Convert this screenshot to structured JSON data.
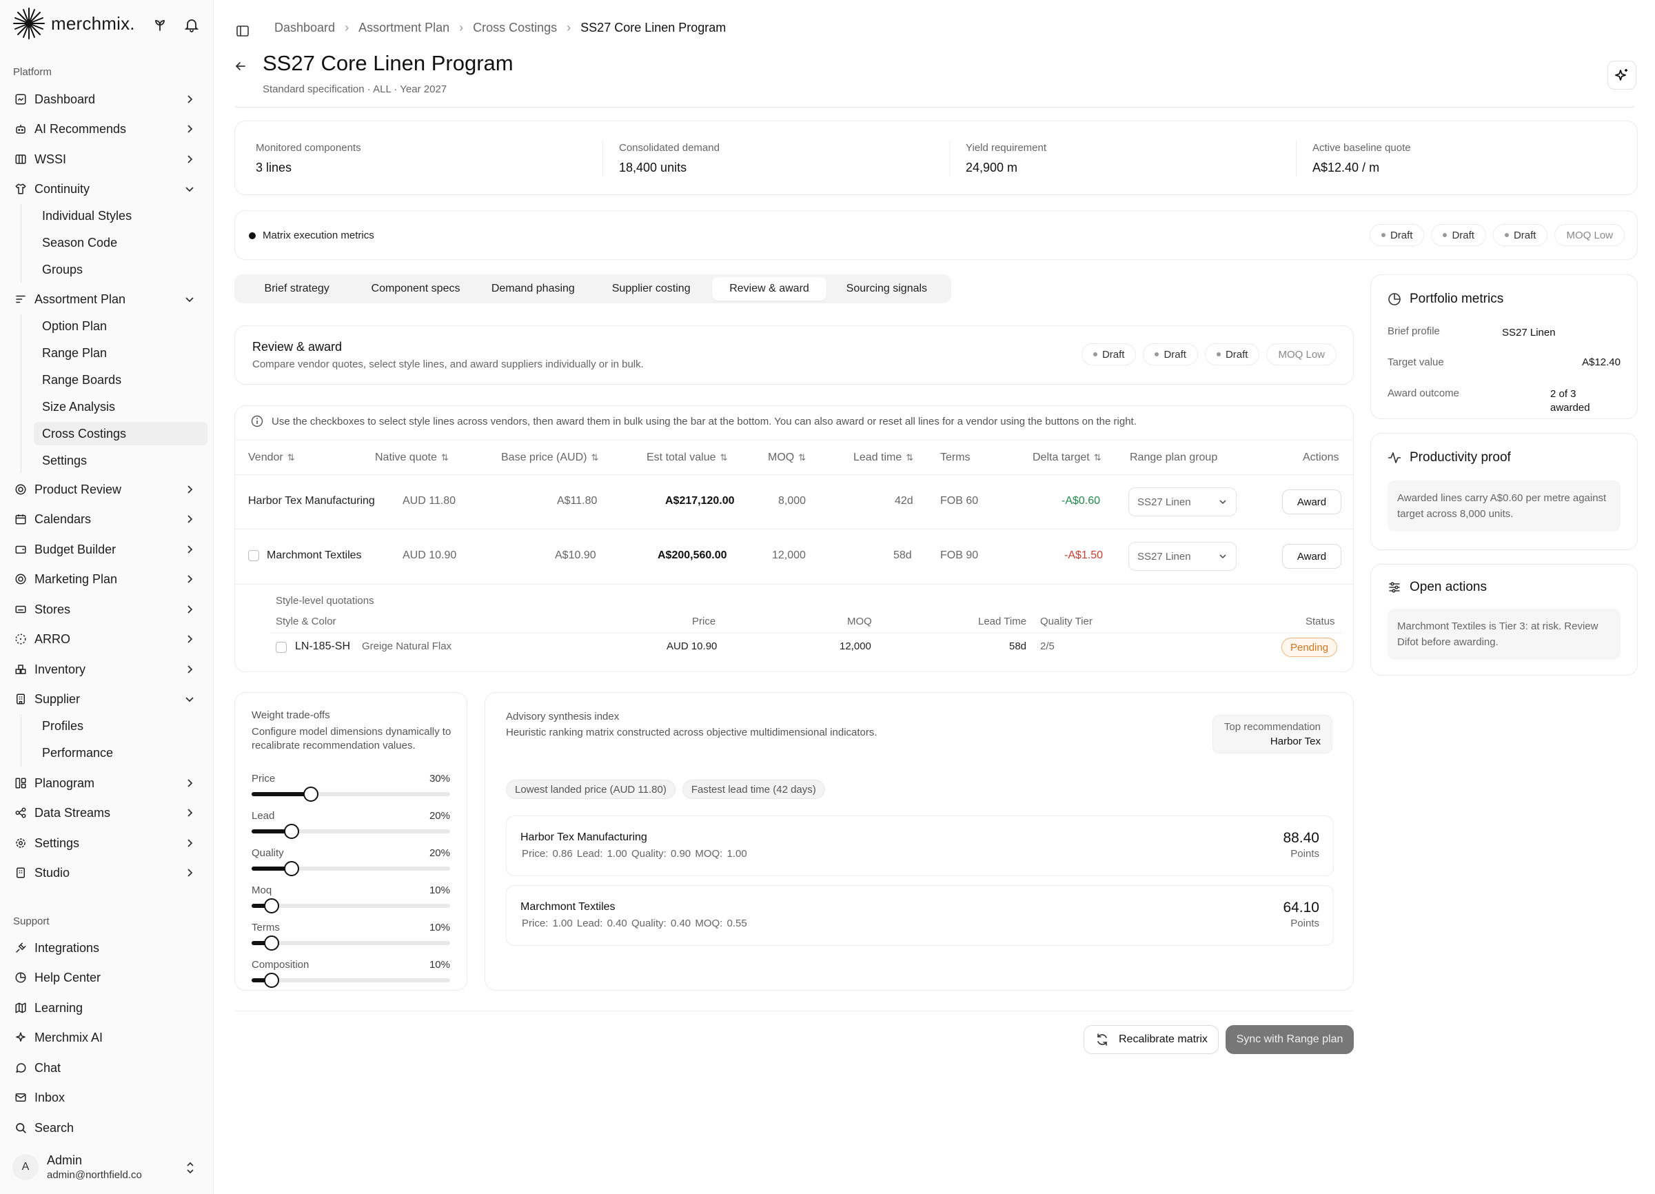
{
  "brand": {
    "name": "merchmix."
  },
  "sidebar": {
    "platform_label": "Platform",
    "support_label": "Support",
    "items": [
      {
        "label": "Dashboard"
      },
      {
        "label": "AI Recommends"
      },
      {
        "label": "WSSI"
      },
      {
        "label": "Continuity"
      },
      {
        "label": "Assortment Plan"
      },
      {
        "label": "Product Review"
      },
      {
        "label": "Calendars"
      },
      {
        "label": "Budget Builder"
      },
      {
        "label": "Marketing Plan"
      },
      {
        "label": "Stores"
      },
      {
        "label": "ARRO"
      },
      {
        "label": "Inventory"
      },
      {
        "label": "Supplier"
      },
      {
        "label": "Planogram"
      },
      {
        "label": "Data Streams"
      },
      {
        "label": "Settings"
      },
      {
        "label": "Studio"
      }
    ],
    "continuity_sub": [
      "Individual Styles",
      "Season Code",
      "Groups"
    ],
    "assortment_sub": [
      "Option Plan",
      "Range Plan",
      "Range Boards",
      "Size Analysis",
      "Cross Costings",
      "Settings"
    ],
    "supplier_sub": [
      "Profiles",
      "Performance"
    ],
    "support_items": [
      {
        "label": "Integrations"
      },
      {
        "label": "Help Center"
      },
      {
        "label": "Learning"
      },
      {
        "label": "Merchmix AI"
      },
      {
        "label": "Chat"
      },
      {
        "label": "Inbox"
      },
      {
        "label": "Search"
      }
    ],
    "user": {
      "initial": "A",
      "name": "Admin",
      "email": "admin@northfield.co"
    }
  },
  "breadcrumb": [
    "Dashboard",
    "Assortment Plan",
    "Cross Costings",
    "SS27 Core Linen Program"
  ],
  "page": {
    "title": "SS27 Core Linen Program",
    "subtitle": "Standard specification · ALL · Year 2027"
  },
  "metrics": [
    {
      "label": "Monitored components",
      "value": "3 lines"
    },
    {
      "label": "Consolidated demand",
      "value": "18,400 units"
    },
    {
      "label": "Yield requirement",
      "value": "24,900 m"
    },
    {
      "label": "Active baseline quote",
      "value": "A$12.40 / m"
    }
  ],
  "execution": {
    "label": "Matrix execution metrics",
    "pills": [
      "Draft",
      "Draft",
      "Draft",
      "MOQ Low"
    ]
  },
  "tabs": [
    "Brief strategy",
    "Component specs",
    "Demand phasing",
    "Supplier costing",
    "Review & award",
    "Sourcing signals"
  ],
  "review": {
    "title": "Review & award",
    "subtitle": "Compare vendor quotes, select style lines, and award suppliers individually or in bulk.",
    "pills": [
      "Draft",
      "Draft",
      "Draft",
      "MOQ Low"
    ],
    "hint": "Use the checkboxes to select style lines across vendors, then award them in bulk using the bar at the bottom. You can also award or reset all lines for a vendor using the buttons on the right."
  },
  "table": {
    "columns": [
      "Vendor",
      "Native quote",
      "Base price (AUD)",
      "Est total value",
      "MOQ",
      "Lead time",
      "Terms",
      "Delta target",
      "Range plan group",
      "Actions"
    ],
    "rows": [
      {
        "vendor": "Harbor Tex Manufacturing",
        "native": "AUD 11.80",
        "base": "A$11.80",
        "total": "A$217,120.00",
        "moq": "8,000",
        "lead": "42d",
        "terms": "FOB 60",
        "delta": "-A$0.60",
        "group": "SS27 Linen",
        "action": "Award"
      },
      {
        "vendor": "Marchmont Textiles",
        "native": "AUD 10.90",
        "base": "A$10.90",
        "total": "A$200,560.00",
        "moq": "12,000",
        "lead": "58d",
        "terms": "FOB 90",
        "delta": "-A$1.50",
        "group": "SS27 Linen",
        "action": "Award"
      }
    ],
    "style_level": {
      "title": "Style-level quotations",
      "columns": [
        "Style & Color",
        "Price",
        "MOQ",
        "Lead Time",
        "Quality Tier",
        "Status"
      ],
      "rows": [
        {
          "code": "LN-185-SH",
          "color": "Greige Natural Flax",
          "price": "AUD 10.90",
          "moq": "12,000",
          "lead": "58d",
          "tier": "2/5",
          "status": "Pending"
        }
      ]
    }
  },
  "weights": {
    "title": "Weight trade-offs",
    "subtitle": "Configure model dimensions dynamically to recalibrate recommendation values.",
    "items": [
      {
        "label": "Price",
        "value": "30%",
        "level": 0.3
      },
      {
        "label": "Lead",
        "value": "20%",
        "level": 0.2
      },
      {
        "label": "Quality",
        "value": "20%",
        "level": 0.2
      },
      {
        "label": "Moq",
        "value": "10%",
        "level": 0.1
      },
      {
        "label": "Terms",
        "value": "10%",
        "level": 0.1
      },
      {
        "label": "Composition",
        "value": "10%",
        "level": 0.1
      }
    ]
  },
  "advisory": {
    "title": "Advisory synthesis index",
    "subtitle": "Heuristic ranking matrix constructed across objective multidimensional indicators.",
    "top_label": "Top recommendation",
    "top_value": "Harbor Tex",
    "chips": [
      "Lowest landed price (AUD 11.80)",
      "Fastest lead time (42 days)"
    ],
    "cards": [
      {
        "name": "Harbor Tex Manufacturing",
        "scores": "Price: 0.86   Lead: 1.00   Quality: 0.90   MOQ: 1.00",
        "points": "88.40",
        "points_label": "Points"
      },
      {
        "name": "Marchmont Textiles",
        "scores": "Price: 1.00   Lead: 0.40   Quality: 0.40   MOQ: 0.55",
        "points": "64.10",
        "points_label": "Points"
      }
    ]
  },
  "actions": {
    "recalibrate": "Recalibrate matrix",
    "sync": "Sync with Range plan"
  },
  "portfolio": {
    "title": "Portfolio metrics",
    "rows": [
      {
        "k": "Brief profile",
        "v": "SS27 Linen"
      },
      {
        "k": "Target value",
        "v": "A$12.40"
      },
      {
        "k": "Award outcome",
        "v": "2 of 3 awarded"
      }
    ]
  },
  "productivity": {
    "title": "Productivity proof",
    "note": "Awarded lines carry A$0.60 per metre against target across 8,000 units."
  },
  "open_actions": {
    "title": "Open actions",
    "note": "Marchmont Textiles is Tier 3: at risk. Review Difot before awarding."
  },
  "colors": {
    "positive": "#1d8b4a",
    "negative": "#d33b2f",
    "pending": "#d8741a"
  }
}
